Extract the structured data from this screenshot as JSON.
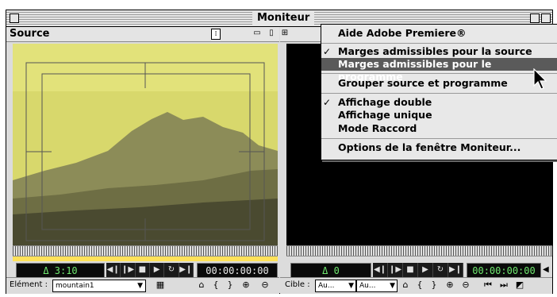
{
  "window": {
    "title": "Moniteur"
  },
  "source": {
    "label": "Source",
    "timecode_delta": "Δ 3:10",
    "timecode": "00:00:00:00",
    "element_label": "Elément :",
    "element_value": "mountain1"
  },
  "program": {
    "timecode_delta": "Δ 0",
    "timecode": "00:00:00:00",
    "target_label": "Cible :",
    "target_video": "Au...",
    "target_audio": "Au..."
  },
  "transport_icons": [
    "step-back-icon",
    "step-forward-icon",
    "stop-icon",
    "play-icon",
    "loop-icon",
    "play-to-out-icon"
  ],
  "menu": {
    "items": [
      {
        "label": "Aide Adobe Premiere®",
        "checked": false,
        "highlighted": false
      },
      {
        "label": "Marges admissibles pour la source",
        "checked": true,
        "highlighted": false
      },
      {
        "label": "Marges admissibles pour le programme",
        "checked": false,
        "highlighted": true
      },
      {
        "label": "Grouper source et programme",
        "checked": false,
        "highlighted": false
      },
      {
        "label": "Affichage double",
        "checked": true,
        "highlighted": false
      },
      {
        "label": "Affichage unique",
        "checked": false,
        "highlighted": false
      },
      {
        "label": "Mode Raccord",
        "checked": false,
        "highlighted": false
      },
      {
        "label": "Options de la fenêtre Moniteur...",
        "checked": false,
        "highlighted": false
      }
    ],
    "check_glyph": "✓"
  },
  "colors": {
    "highlight": "#5a5a5a",
    "lcd_green": "#6fe86f",
    "sky": "#d8d86c"
  }
}
